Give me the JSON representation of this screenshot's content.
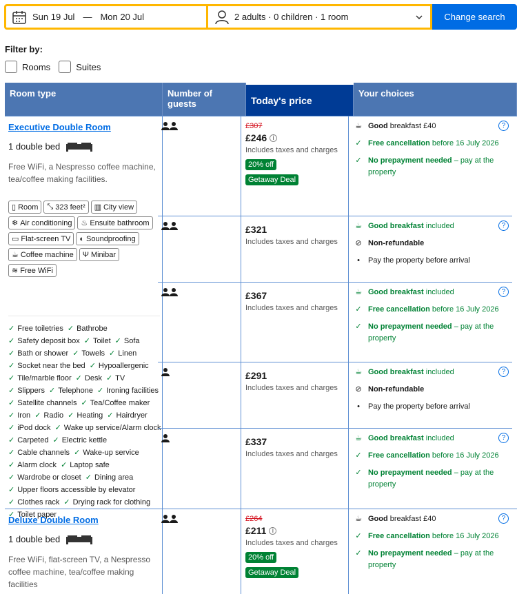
{
  "search": {
    "checkin": "Sun 19 Jul",
    "dash": "—",
    "checkout": "Mon 20 Jul",
    "guests": "2 adults · 0 children · 1 room",
    "button": "Change search"
  },
  "filter": {
    "title": "Filter by:",
    "options": [
      "Rooms",
      "Suites"
    ]
  },
  "table": {
    "headers": [
      "Room type",
      "Number of guests",
      "Today's price",
      "Your choices"
    ]
  },
  "rooms": [
    {
      "name": "Executive Double Room",
      "bed": "1 double bed",
      "desc": "Free WiFi, a Nespresso coffee machine, tea/coffee making facilities.",
      "facilities": [
        "Room",
        "323 feet²",
        "City view",
        "Air conditioning",
        "Ensuite bathroom",
        "Flat-screen TV",
        "Soundproofing",
        "Coffee machine",
        "Minibar",
        "Free WiFi"
      ],
      "amenities": [
        "Free toiletries",
        "Bathrobe",
        "Safety deposit box",
        "Toilet",
        "Sofa",
        "Bath or shower",
        "Towels",
        "Linen",
        "Socket near the bed",
        "Hypoallergenic",
        "Tile/marble floor",
        "Desk",
        "TV",
        "Slippers",
        "Telephone",
        "Ironing facilities",
        "Satellite channels",
        "Tea/Coffee maker",
        "Iron",
        "Radio",
        "Heating",
        "Hairdryer",
        "iPod dock",
        "Wake up service/Alarm clock",
        "Carpeted",
        "Electric kettle",
        "Cable channels",
        "Wake-up service",
        "Alarm clock",
        "Laptop safe",
        "Wardrobe or closet",
        "Dining area",
        "Upper floors accessible by elevator",
        "Clothes rack",
        "Drying rack for clothing",
        "Toilet paper"
      ]
    },
    {
      "name": "Deluxe Double Room",
      "bed": "1 double bed",
      "desc": "Free WiFi, flat-screen TV, a Nespresso coffee machine, tea/coffee making facilities"
    }
  ],
  "offers": [
    {
      "old_price": "£307",
      "price": "£246",
      "taxes": "Includes taxes and charges",
      "discount": "20% off",
      "deal": "Getaway Deal",
      "c1_bold": "Good",
      "c1_rest": " breakfast £40",
      "c2_bold": "Free cancellation",
      "c2_rest": " before 16 July 2026",
      "c3_bold": "No prepayment needed",
      "c3_rest": " – pay at the property"
    },
    {
      "price": "£321",
      "taxes": "Includes taxes and charges",
      "c1_bold": "Good breakfast",
      "c1_rest": " included",
      "c2_bold": "Non-refundable",
      "c3_rest": "Pay the property before arrival"
    },
    {
      "price": "£367",
      "taxes": "Includes taxes and charges",
      "c1_bold": "Good breakfast",
      "c1_rest": " included",
      "c2_bold": "Free cancellation",
      "c2_rest": " before 16 July 2026",
      "c3_bold": "No prepayment needed",
      "c3_rest": " – pay at the property"
    },
    {
      "price": "£291",
      "taxes": "Includes taxes and charges",
      "c1_bold": "Good breakfast",
      "c1_rest": " included",
      "c2_bold": "Non-refundable",
      "c3_rest": "Pay the property before arrival"
    },
    {
      "price": "£337",
      "taxes": "Includes taxes and charges",
      "c1_bold": "Good breakfast",
      "c1_rest": " included",
      "c2_bold": "Free cancellation",
      "c2_rest": " before 16 July 2026",
      "c3_bold": "No prepayment needed",
      "c3_rest": " – pay at the property"
    },
    {
      "old_price": "£264",
      "price": "£211",
      "taxes": "Includes taxes and charges",
      "discount": "20% off",
      "deal": "Getaway Deal",
      "c1_bold": "Good",
      "c1_rest": " breakfast £40",
      "c2_bold": "Free cancellation",
      "c2_rest": " before 16 July 2026",
      "c3_bold": "No prepayment needed",
      "c3_rest": " – pay at the property"
    }
  ],
  "icons": {
    "help": "?",
    "info": "i"
  },
  "colors": {
    "brand_blue": "#006ce4",
    "header_blue": "#4c76b2",
    "price_header": "#003b95",
    "green": "#008234",
    "red": "#d4111e",
    "yellow": "#ffb700"
  }
}
